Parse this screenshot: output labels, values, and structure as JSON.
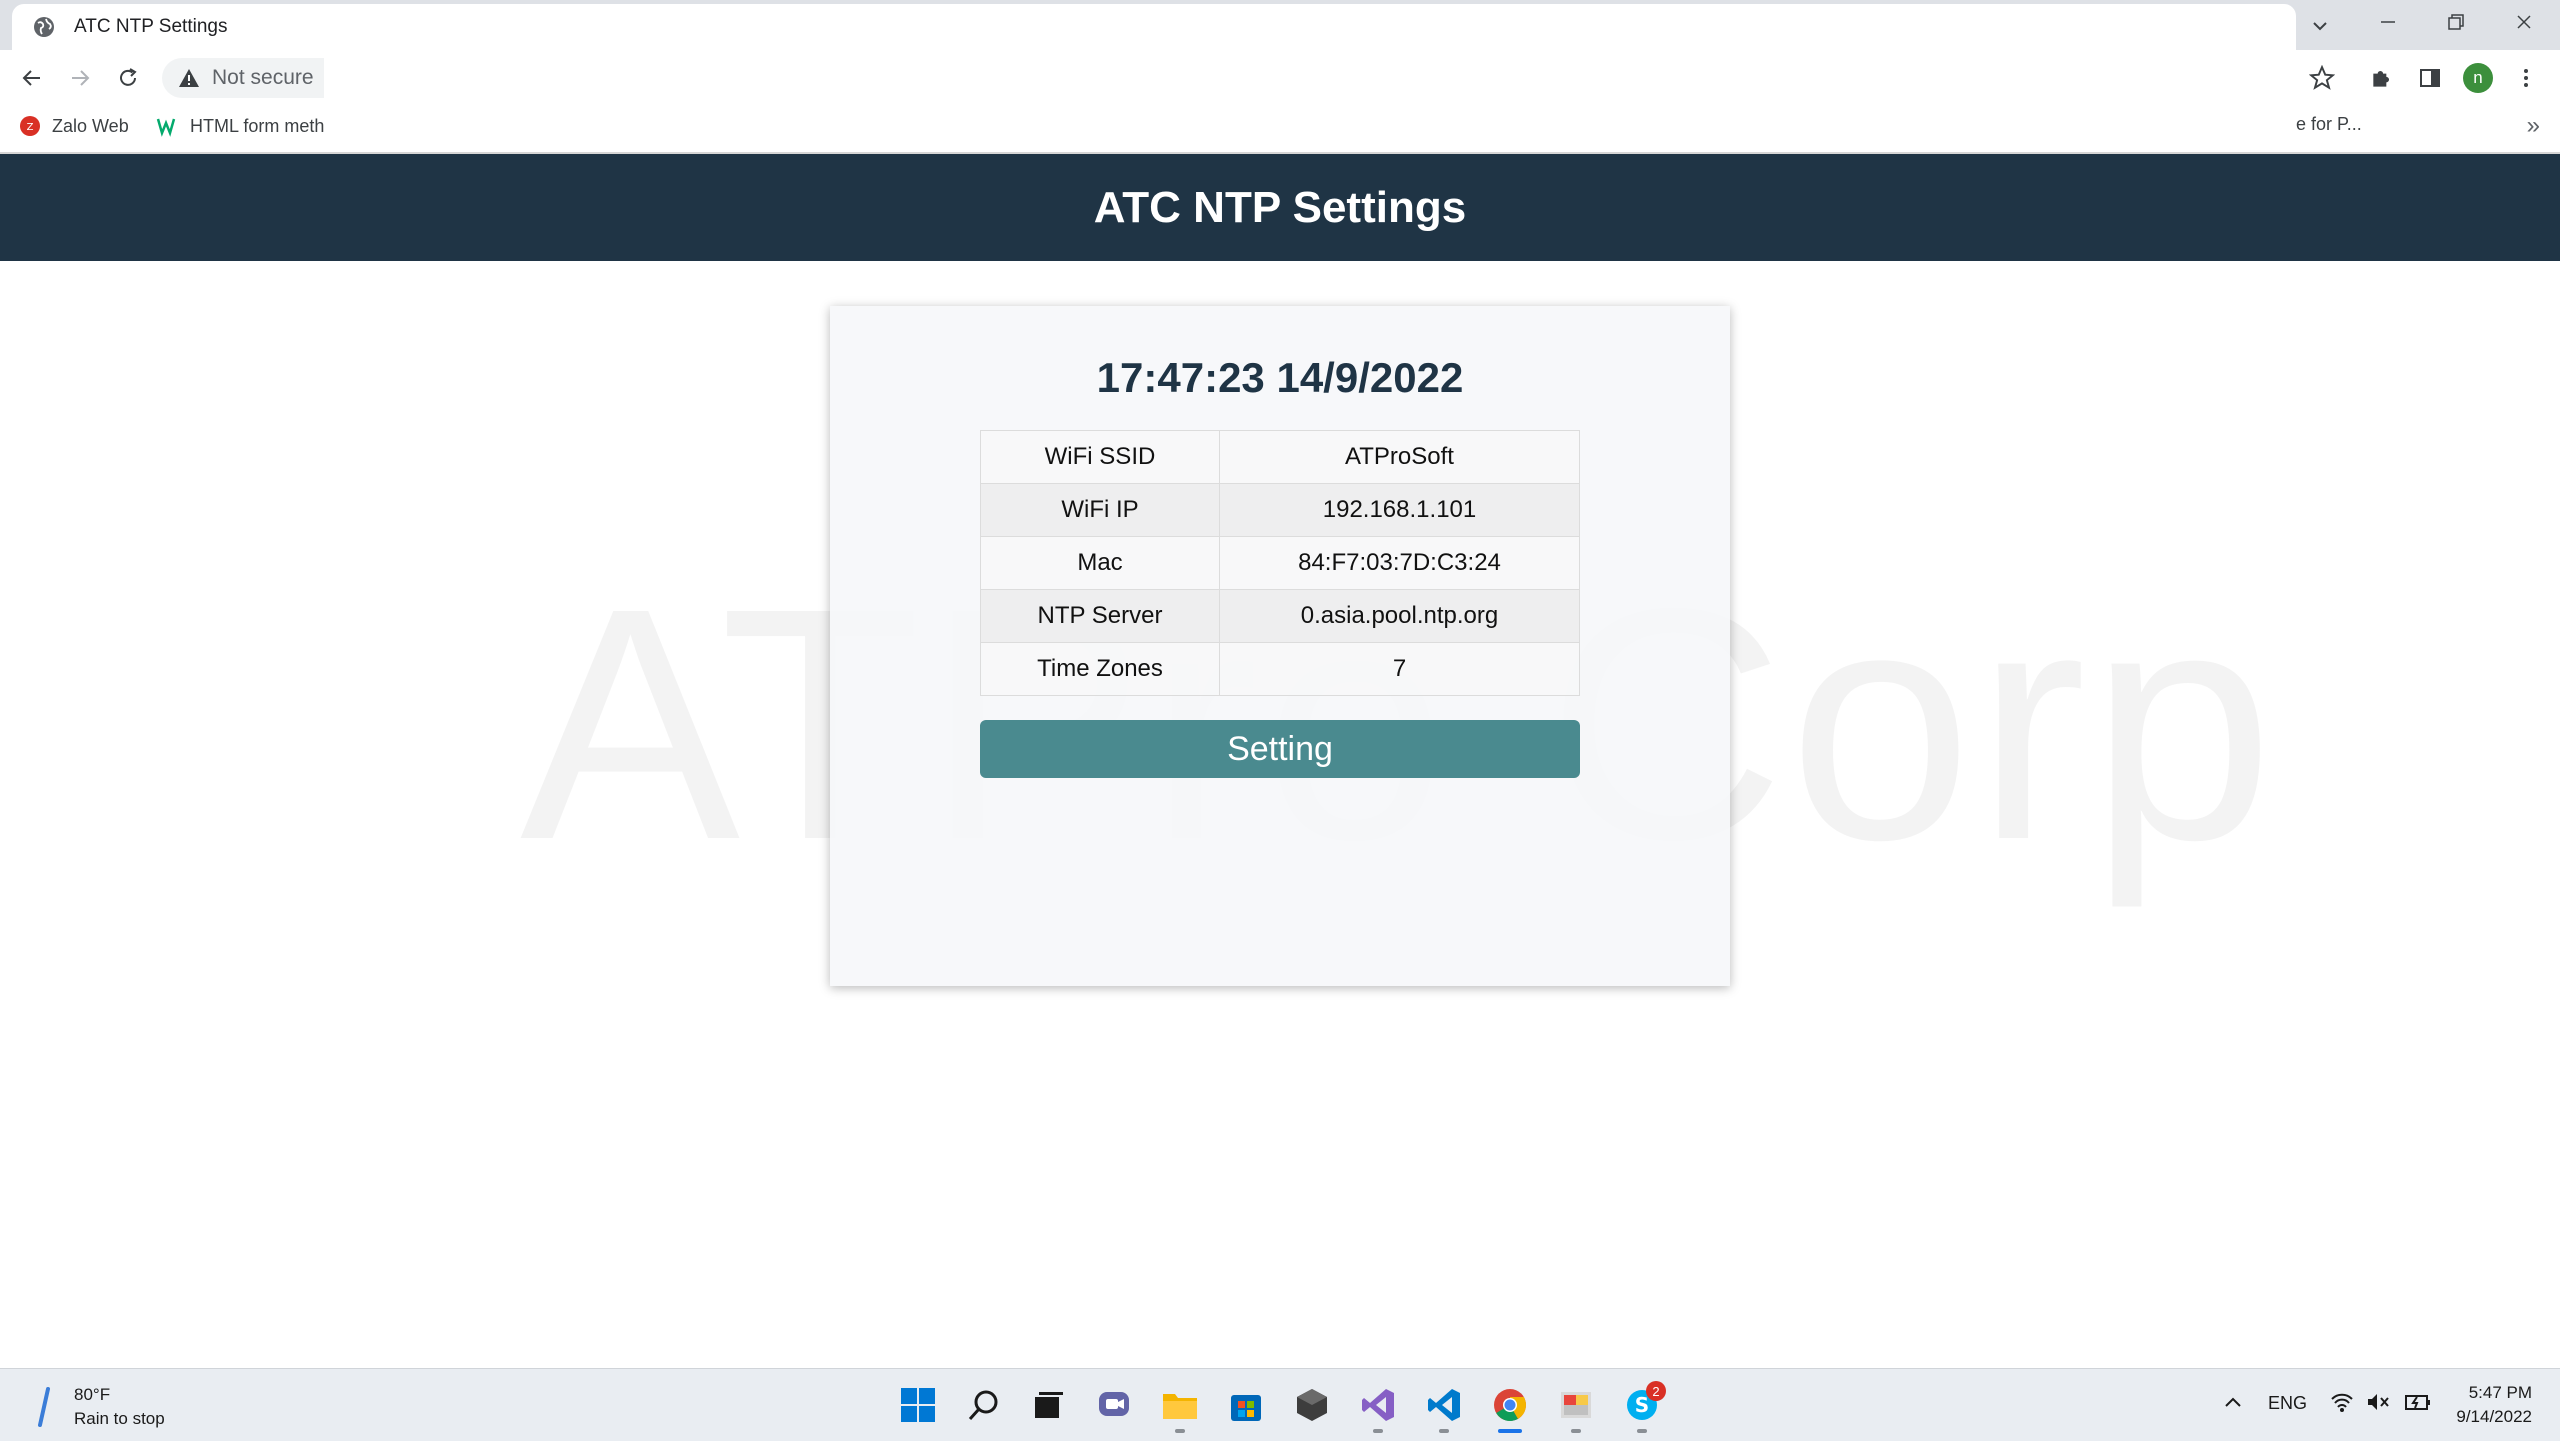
{
  "browser": {
    "tab_title": "ATC NTP Settings",
    "security_label": "Not secure",
    "profile_initial": "n",
    "bookmarks": [
      {
        "label": "Zalo Web"
      },
      {
        "label": "HTML form meth"
      },
      {
        "label": "e for P..."
      }
    ],
    "bookmarks_more": "»"
  },
  "page": {
    "header_title": "ATC NTP Settings",
    "watermark": "ATPro Corp",
    "datetime": "17:47:23 14/9/2022",
    "info_rows": [
      {
        "key": "WiFi SSID",
        "value": "ATProSoft"
      },
      {
        "key": "WiFi IP",
        "value": "192.168.1.101"
      },
      {
        "key": "Mac",
        "value": "84:F7:03:7D:C3:24"
      },
      {
        "key": "NTP Server",
        "value": "0.asia.pool.ntp.org"
      },
      {
        "key": "Time Zones",
        "value": "7"
      }
    ],
    "setting_button": "Setting"
  },
  "taskbar": {
    "weather_temp": "80°F",
    "weather_desc": "Rain to stop",
    "skype_badge": "2",
    "language": "ENG",
    "time": "5:47 PM",
    "date": "9/14/2022"
  },
  "colors": {
    "header_bg": "#1f3445",
    "button_bg": "#4a8a8f",
    "datetime_color": "#1f3445"
  }
}
